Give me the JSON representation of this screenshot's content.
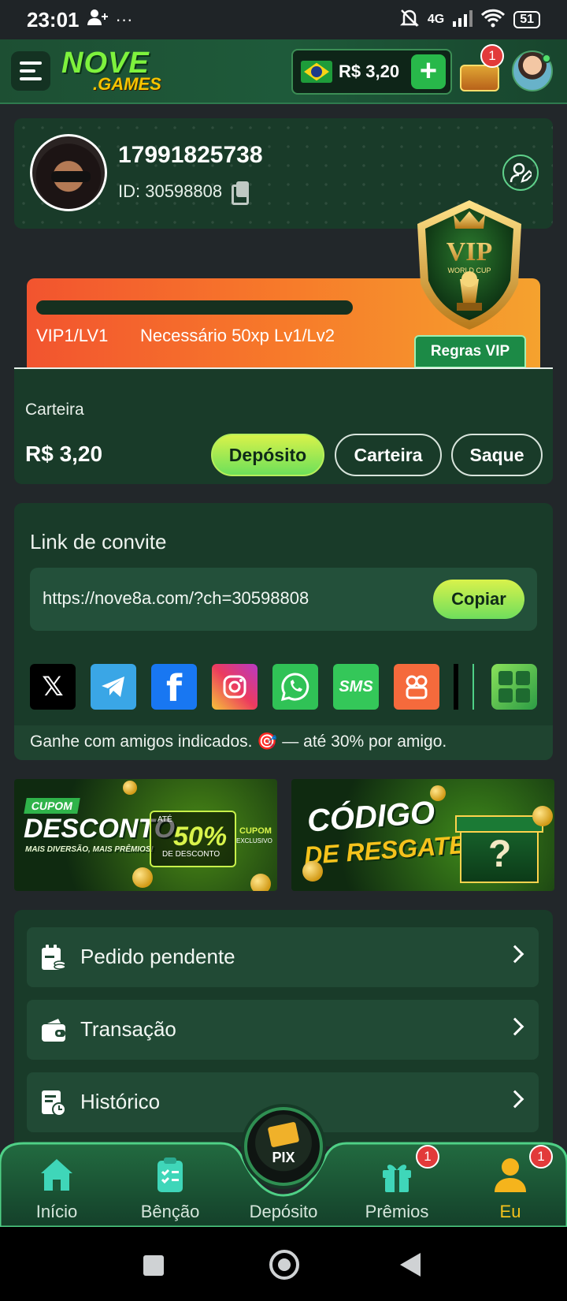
{
  "status_bar": {
    "time": "23:01",
    "network": "4G",
    "battery": "51"
  },
  "header": {
    "logo_top": "NOVE",
    "logo_bottom": ".GAMES",
    "balance": "R$ 3,20",
    "plus": "+",
    "chest_badge": "1"
  },
  "profile": {
    "username": "17991825738",
    "user_id": "ID: 30598808"
  },
  "vip": {
    "level": "VIP1/LV1",
    "requirement": "Necessário 50xp Lv1/Lv2",
    "rules_button": "Regras VIP",
    "shield_text": "VIP",
    "shield_sub": "WORLD CUP",
    "progress": 0
  },
  "wallet": {
    "title": "Carteira",
    "amount": "R$ 3,20",
    "deposit_button": "Depósito",
    "wallet_button": "Carteira",
    "withdraw_button": "Saque"
  },
  "invite": {
    "title": "Link de convite",
    "link": "https://nove8a.com/?ch=30598808",
    "copy_button": "Copiar",
    "note": "Ganhe com amigos indicados. 🎯 — até 30% por amigo.",
    "share_sms_label": "SMS",
    "share_x_label": "𝕏",
    "share_facebook_label": "f"
  },
  "banners": {
    "discount": {
      "tag": "CUPOM",
      "title": "DESCONTO",
      "subtitle": "MAIS DIVERSÃO, MAIS PRÊMIOS!",
      "up_to": "ATÉ",
      "percent": "50%",
      "percent_sub": "DE DESCONTO",
      "coupon_label": "CUPOM",
      "coupon_sub": "EXCLUSIVO"
    },
    "redeem": {
      "title_line1": "CÓDIGO",
      "title_line2": "DE RESGATE",
      "mark": "?"
    }
  },
  "menu": {
    "items": [
      {
        "label": "Pedido pendente"
      },
      {
        "label": "Transação"
      },
      {
        "label": "Histórico"
      }
    ]
  },
  "bottom_nav": {
    "items": [
      {
        "label": "Início"
      },
      {
        "label": "Bênção"
      },
      {
        "label": "Depósito"
      },
      {
        "label": "Prêmios",
        "badge": "1"
      },
      {
        "label": "Eu",
        "badge": "1"
      }
    ],
    "pix_label": "PIX",
    "active": "Eu"
  },
  "colors": {
    "accent_green": "#2fb34a",
    "active_nav": "#f5c21c",
    "badge_red": "#e23a3a"
  }
}
